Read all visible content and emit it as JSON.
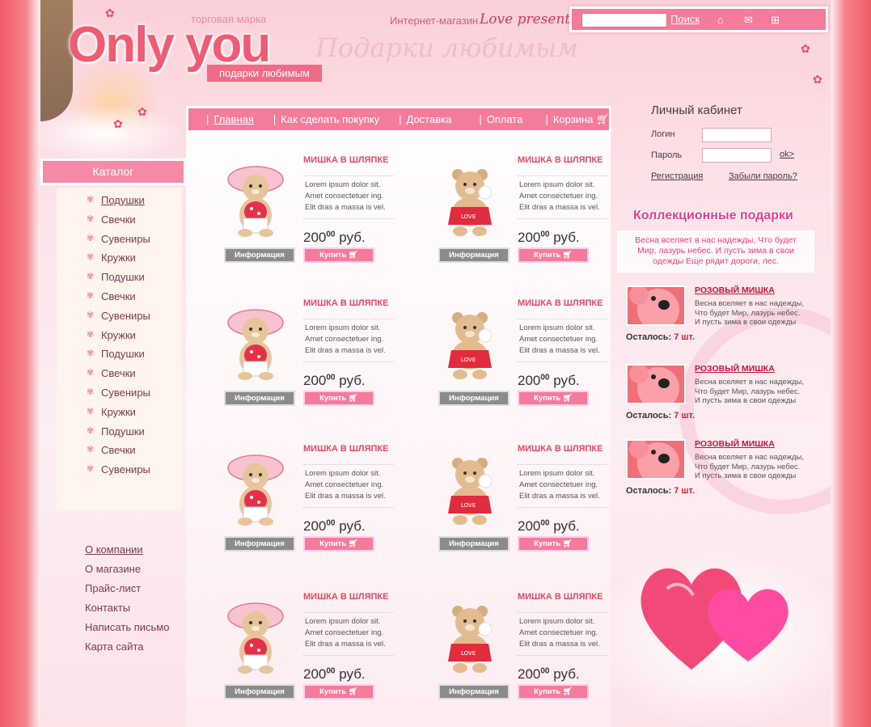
{
  "header": {
    "trademark": "торговая марка",
    "logo": "Only you",
    "tagline": "подарки любимым",
    "watermark": "Подарки любимым",
    "shop_label": "Интернет-магазин",
    "shop_name": "Love presents"
  },
  "search": {
    "placeholder": "",
    "button": "Поиск"
  },
  "top_icons": [
    "home-icon",
    "mail-icon",
    "sitemap-icon"
  ],
  "nav": [
    {
      "label": "Главная",
      "active": true
    },
    {
      "label": "Как сделать покупку"
    },
    {
      "label": "Доставка"
    },
    {
      "label": "Оплата"
    },
    {
      "label": "Корзина"
    }
  ],
  "catalog": {
    "title": "Каталог",
    "items": [
      "Подушки",
      "Свечки",
      "Сувениры",
      "Кружки",
      "Подушки",
      "Свечки",
      "Сувениры",
      "Кружки",
      "Подушки",
      "Свечки",
      "Сувениры",
      "Кружки",
      "Подушки",
      "Свечки",
      "Сувениры"
    ]
  },
  "footer_links": [
    "О компании",
    "О магазине",
    "Прайс-лист",
    "Контакты",
    "Написать письмо",
    "Карта сайта"
  ],
  "products": [
    {
      "title": "МИШКА В ШЛЯПКЕ",
      "desc": [
        "Lorem ipsum dolor sit.",
        "Amet consectetuer ing.",
        "Elit dras a massa is vel."
      ],
      "price": "200",
      "cents": "00",
      "currency": "руб.",
      "info": "Информация",
      "buy": "Купить"
    },
    {
      "title": "МИШКА В ШЛЯПКЕ",
      "desc": [
        "Lorem ipsum dolor sit.",
        "Amet consectetuer ing.",
        "Elit dras a massa is vel."
      ],
      "price": "200",
      "cents": "00",
      "currency": "руб.",
      "info": "Информация",
      "buy": "Купить"
    },
    {
      "title": "МИШКА В ШЛЯПКЕ",
      "desc": [
        "Lorem ipsum dolor sit.",
        "Amet consectetuer ing.",
        "Elit dras a massa is vel."
      ],
      "price": "200",
      "cents": "00",
      "currency": "руб.",
      "info": "Информация",
      "buy": "Купить"
    },
    {
      "title": "МИШКА В ШЛЯПКЕ",
      "desc": [
        "Lorem ipsum dolor sit.",
        "Amet consectetuer ing.",
        "Elit dras a massa is vel."
      ],
      "price": "200",
      "cents": "00",
      "currency": "руб.",
      "info": "Информация",
      "buy": "Купить"
    },
    {
      "title": "МИШКА В ШЛЯПКЕ",
      "desc": [
        "Lorem ipsum dolor sit.",
        "Amet consectetuer ing.",
        "Elit dras a massa is vel."
      ],
      "price": "200",
      "cents": "00",
      "currency": "руб.",
      "info": "Информация",
      "buy": "Купить"
    },
    {
      "title": "МИШКА В ШЛЯПКЕ",
      "desc": [
        "Lorem ipsum dolor sit.",
        "Amet consectetuer ing.",
        "Elit dras a massa is vel."
      ],
      "price": "200",
      "cents": "00",
      "currency": "руб.",
      "info": "Информация",
      "buy": "Купить"
    },
    {
      "title": "МИШКА В ШЛЯПКЕ",
      "desc": [
        "Lorem ipsum dolor sit.",
        "Amet consectetuer ing.",
        "Elit dras a massa is vel."
      ],
      "price": "200",
      "cents": "00",
      "currency": "руб.",
      "info": "Информация",
      "buy": "Купить"
    },
    {
      "title": "МИШКА В ШЛЯПКЕ",
      "desc": [
        "Lorem ipsum dolor sit.",
        "Amet consectetuer ing.",
        "Elit dras a massa is vel."
      ],
      "price": "200",
      "cents": "00",
      "currency": "руб.",
      "info": "Информация",
      "buy": "Купить"
    }
  ],
  "cabinet": {
    "title": "Личный кабинет",
    "login_label": "Логин",
    "password_label": "Пароль",
    "ok": "ok>",
    "register": "Регистрация",
    "forgot": "Забыли пароль?"
  },
  "collection": {
    "title": "Коллекционные подарки",
    "intro": "Весна вселяет в нас надежды, Что будет Мир, лазурь небес. И пусть зима в свои одежды Еще рядит дороги, лес.",
    "items": [
      {
        "title": "РОЗОВЫЙ МИШКА",
        "desc": [
          "Весна вселяет в нас надежды,",
          "Что будет Мир, лазурь небес.",
          "И пусть зима в свои одежды"
        ],
        "remain_label": "Осталось:",
        "remain": "7 шт."
      },
      {
        "title": "РОЗОВЫЙ МИШКА",
        "desc": [
          "Весна вселяет в нас надежды,",
          "Что будет Мир, лазурь небес.",
          "И пусть зима в свои одежды"
        ],
        "remain_label": "Осталось:",
        "remain": "7 шт."
      },
      {
        "title": "РОЗОВЫЙ МИШКА",
        "desc": [
          "Весна вселяет в нас надежды,",
          "Что будет Мир, лазурь небес.",
          "И пусть зима в свои одежды"
        ],
        "remain_label": "Осталось:",
        "remain": "7 шт."
      }
    ]
  },
  "colors": {
    "accent": "#f47b9a",
    "title_red": "#e04a64",
    "brand_pink": "#f05b74"
  }
}
